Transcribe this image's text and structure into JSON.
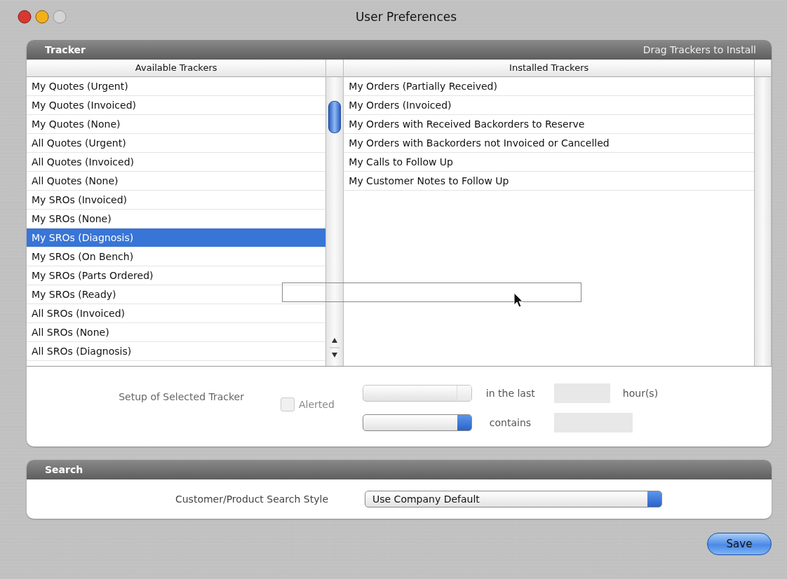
{
  "window": {
    "title": "User Preferences"
  },
  "tracker": {
    "title": "Tracker",
    "hint": "Drag Trackers to Install",
    "available": {
      "heading": "Available Trackers",
      "items": [
        {
          "label": "My Quotes (Urgent)",
          "selected": false
        },
        {
          "label": "My Quotes (Invoiced)",
          "selected": false
        },
        {
          "label": "My Quotes (None)",
          "selected": false
        },
        {
          "label": "All Quotes (Urgent)",
          "selected": false
        },
        {
          "label": "All Quotes (Invoiced)",
          "selected": false
        },
        {
          "label": "All Quotes (None)",
          "selected": false
        },
        {
          "label": "My SROs (Invoiced)",
          "selected": false
        },
        {
          "label": "My SROs (None)",
          "selected": false
        },
        {
          "label": "My SROs (Diagnosis)",
          "selected": true
        },
        {
          "label": "My SROs (On Bench)",
          "selected": false
        },
        {
          "label": "My SROs (Parts Ordered)",
          "selected": false
        },
        {
          "label": "My SROs (Ready)",
          "selected": false
        },
        {
          "label": "All SROs (Invoiced)",
          "selected": false
        },
        {
          "label": "All SROs (None)",
          "selected": false
        },
        {
          "label": "All SROs (Diagnosis)",
          "selected": false
        }
      ]
    },
    "installed": {
      "heading": "Installed Trackers",
      "items": [
        {
          "label": "My Orders (Partially Received)",
          "selected": false
        },
        {
          "label": "My Orders (Invoiced)",
          "selected": false
        },
        {
          "label": "My Orders with Received Backorders to Reserve",
          "selected": false
        },
        {
          "label": "My Orders with Backorders not Invoiced or Cancelled",
          "selected": false
        },
        {
          "label": "My Calls to Follow Up",
          "selected": false
        },
        {
          "label": "My Customer Notes to Follow Up",
          "selected": false
        }
      ]
    },
    "setup": {
      "label": "Setup of Selected Tracker",
      "alerted": {
        "label": "Alerted",
        "checked": false,
        "disabled": true
      },
      "period_select": {
        "disabled": true
      },
      "in_the_last": "in the last",
      "hours": "hour(s)",
      "field_select": {
        "disabled": false
      },
      "contains": "contains"
    }
  },
  "search": {
    "title": "Search",
    "label": "Customer/Product Search Style",
    "value": "Use Company Default"
  },
  "buttons": [
    "Save"
  ]
}
